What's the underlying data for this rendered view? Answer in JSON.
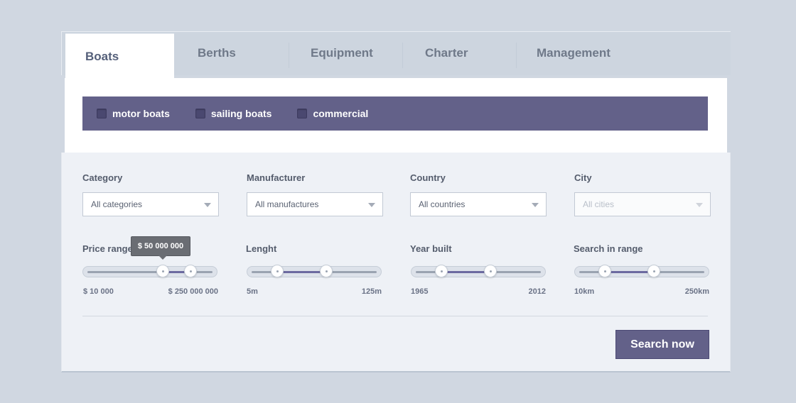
{
  "tabs": [
    {
      "label": "Boats"
    },
    {
      "label": "Berths"
    },
    {
      "label": "Equipment"
    },
    {
      "label": "Charter"
    },
    {
      "label": "Management"
    }
  ],
  "boat_types": [
    {
      "label": "motor boats"
    },
    {
      "label": "sailing boats"
    },
    {
      "label": "commercial"
    }
  ],
  "filters": {
    "category": {
      "label": "Category",
      "value": "All categories"
    },
    "manufacturer": {
      "label": "Manufacturer",
      "value": "All manufactures"
    },
    "country": {
      "label": "Country",
      "value": "All countries"
    },
    "city": {
      "label": "City",
      "value": "All cities"
    }
  },
  "ranges": {
    "price": {
      "label": "Price range",
      "min_label": "$ 10 000",
      "max_label": "$ 250 000 000",
      "tooltip": "$ 50 000 000"
    },
    "length": {
      "label": "Lenght",
      "min_label": "5m",
      "max_label": "125m"
    },
    "year": {
      "label": "Year built",
      "min_label": "1965",
      "max_label": "2012"
    },
    "search_range": {
      "label": "Search in range",
      "min_label": "10km",
      "max_label": "250km"
    }
  },
  "search_button": "Search now",
  "colors": {
    "accent": "#636189",
    "background": "#d0d7e1",
    "panel": "#eef1f6"
  }
}
